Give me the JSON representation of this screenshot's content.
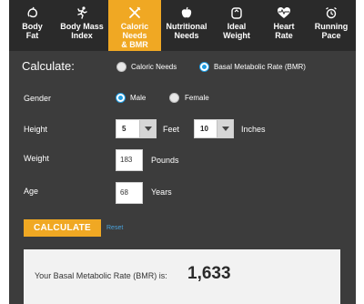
{
  "nav": {
    "tabs": [
      {
        "label": "Body\nFat",
        "icon": "apple-cursive-icon",
        "active": false
      },
      {
        "label": "Body Mass\nIndex",
        "icon": "running-figure-icon",
        "active": false
      },
      {
        "label": "Caloric Needs\n& BMR",
        "icon": "fork-knife-icon",
        "active": true
      },
      {
        "label": "Nutritional\nNeeds",
        "icon": "apple-icon",
        "active": false
      },
      {
        "label": "Ideal\nWeight",
        "icon": "scale-icon",
        "active": false
      },
      {
        "label": "Heart\nRate",
        "icon": "heart-pulse-icon",
        "active": false
      },
      {
        "label": "Running\nPace",
        "icon": "alarm-clock-icon",
        "active": false
      }
    ]
  },
  "form": {
    "heading": "Calculate:",
    "calculate_options": [
      {
        "label": "Caloric Needs",
        "checked": false
      },
      {
        "label": "Basal Metabolic Rate (BMR)",
        "checked": true
      }
    ],
    "gender_label": "Gender",
    "gender_options": [
      {
        "label": "Male",
        "checked": true
      },
      {
        "label": "Female",
        "checked": false
      }
    ],
    "height_label": "Height",
    "height_feet_value": "5",
    "height_feet_unit": "Feet",
    "height_inches_value": "10",
    "height_inches_unit": "Inches",
    "weight_label": "Weight",
    "weight_value": "183",
    "weight_unit": "Pounds",
    "age_label": "Age",
    "age_value": "68",
    "age_unit": "Years",
    "calculate_button": "CALCULATE",
    "reset_link": "Reset"
  },
  "result": {
    "label": "Your Basal Metabolic Rate (BMR) is:",
    "value": "1,633"
  },
  "colors": {
    "accent": "#f0a823",
    "nav_bg": "#2a2a2a",
    "panel_bg": "#3c3c3c",
    "radio_checked": "#1e9be0",
    "link": "#4aa3dc"
  }
}
